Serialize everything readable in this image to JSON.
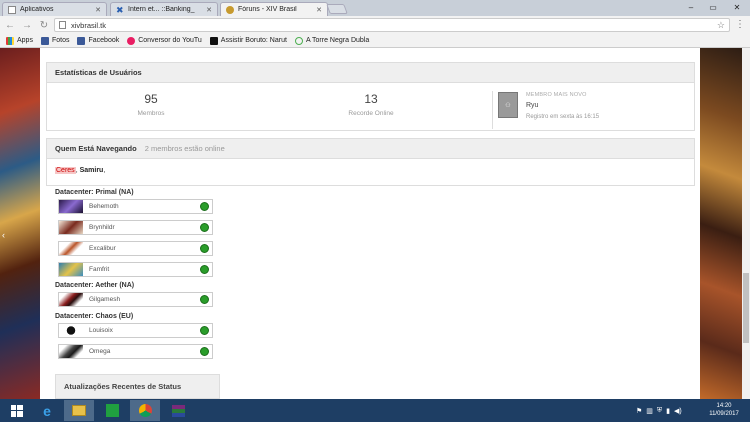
{
  "browser": {
    "tabs": [
      {
        "title": "Aplicativos",
        "active": false
      },
      {
        "title": "Intern et... ::Banking_",
        "active": false
      },
      {
        "title": "Fóruns - XIV Brasil",
        "active": true
      }
    ],
    "url": "xivbrasil.tk",
    "bookmarks": [
      "Apps",
      "Fotos",
      "Facebook",
      "Conversor do YouTu",
      "Assistir Boruto: Narut",
      "A Torre Negra Dubla"
    ]
  },
  "stats": {
    "title": "Estatísticas de Usuários",
    "members_value": "95",
    "members_label": "Membros",
    "record_value": "13",
    "record_label": "Recorde Online",
    "newest_caption": "MEMBRO MAIS NOVO",
    "newest_name": "Ryu",
    "newest_date": "Registro em sexta às 16:15"
  },
  "browsing": {
    "title": "Quem Está Navegando",
    "subtitle": "2 membros estão online",
    "user1": "Ceres",
    "separator": ",",
    "user2": "Samiru",
    "end": ","
  },
  "datacenters": [
    {
      "name": "Datacenter: Primal (NA)",
      "servers": [
        "Behemoth",
        "Brynhildr",
        "Excalibur",
        "Famfrit"
      ]
    },
    {
      "name": "Datacenter: Aether (NA)",
      "servers": [
        "Gilgamesh"
      ]
    },
    {
      "name": "Datacenter: Chaos (EU)",
      "servers": [
        "Louisoix",
        "Omega"
      ]
    }
  ],
  "status_panel": {
    "title": "Atualizações Recentes de Status"
  },
  "taskbar": {
    "time": "14:20",
    "date": "11/09/2017"
  },
  "colors": {
    "online": "#2a9d2a",
    "taskbar": "#1e3e64"
  }
}
